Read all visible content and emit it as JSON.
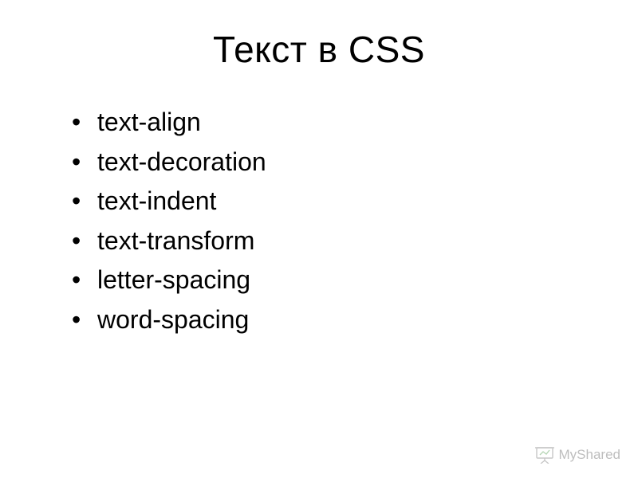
{
  "slide": {
    "title": "Текст в CSS",
    "bullets": [
      "text-align",
      "text-decoration",
      "text-indent",
      "text-transform",
      "letter-spacing",
      "word-spacing"
    ]
  },
  "watermark": {
    "text": "MyShared"
  }
}
